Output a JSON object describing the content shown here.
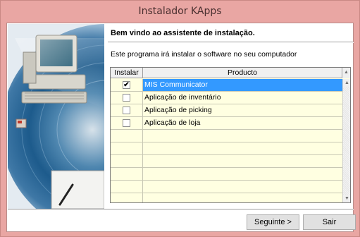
{
  "window": {
    "title": "Instalador KApps"
  },
  "wizard": {
    "heading": "Bem vindo ao assistente de instalação.",
    "description": "Este programa irá instalar o software no seu computador"
  },
  "table": {
    "columns": [
      "Instalar",
      "Producto"
    ],
    "rows": [
      {
        "checked": true,
        "name": "MIS Communicator",
        "selected": true
      },
      {
        "checked": false,
        "name": "Aplicação de inventário",
        "selected": false
      },
      {
        "checked": false,
        "name": "Aplicação de picking",
        "selected": false
      },
      {
        "checked": false,
        "name": "Aplicação de loja",
        "selected": false
      },
      {
        "checked": null,
        "name": "",
        "selected": false
      },
      {
        "checked": null,
        "name": "",
        "selected": false
      },
      {
        "checked": null,
        "name": "",
        "selected": false
      },
      {
        "checked": null,
        "name": "",
        "selected": false
      },
      {
        "checked": null,
        "name": "",
        "selected": false
      },
      {
        "checked": null,
        "name": "",
        "selected": false
      }
    ]
  },
  "buttons": {
    "next": "Seguinte >",
    "exit": "Sair"
  },
  "colors": {
    "titlebar": "#e9a6a3",
    "selection": "#3399ff",
    "grid_bg": "#ffffe1"
  }
}
